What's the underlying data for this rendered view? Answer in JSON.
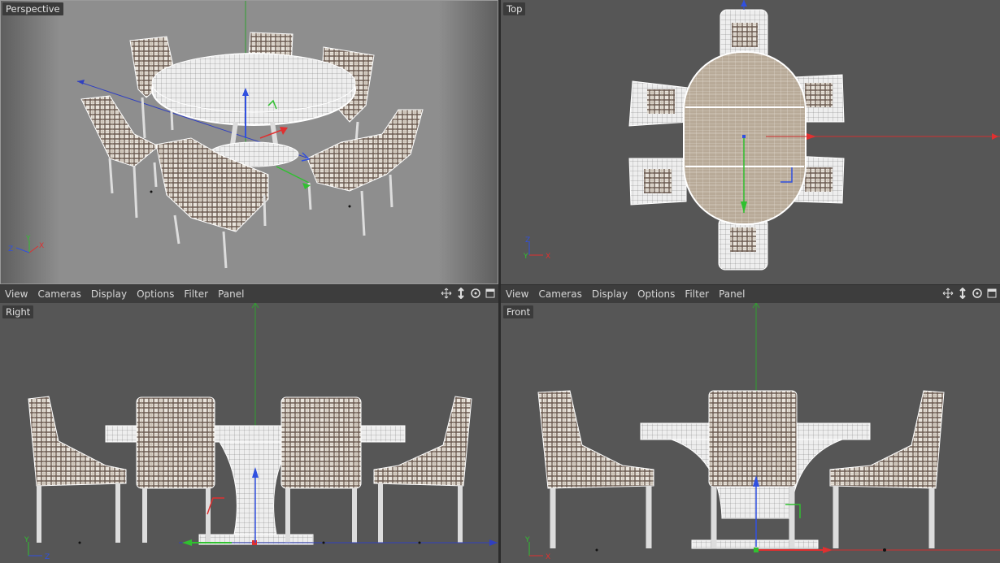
{
  "viewports": {
    "perspective": {
      "label": "Perspective"
    },
    "top": {
      "label": "Top"
    },
    "right": {
      "label": "Right"
    },
    "front": {
      "label": "Front"
    }
  },
  "menu": [
    "View",
    "Cameras",
    "Display",
    "Options",
    "Filter",
    "Panel"
  ],
  "axes": {
    "x": "X",
    "y": "Y",
    "z": "Z"
  },
  "nav_icons": [
    "move-view-icon",
    "dolly-view-icon",
    "rotate-view-icon",
    "maximize-view-icon"
  ],
  "colors": {
    "viewport_bg": "#565656",
    "perspective_bg": "#8a8a8a",
    "axis_x": "#e03030",
    "axis_y": "#30c030",
    "axis_z": "#3040e0"
  }
}
